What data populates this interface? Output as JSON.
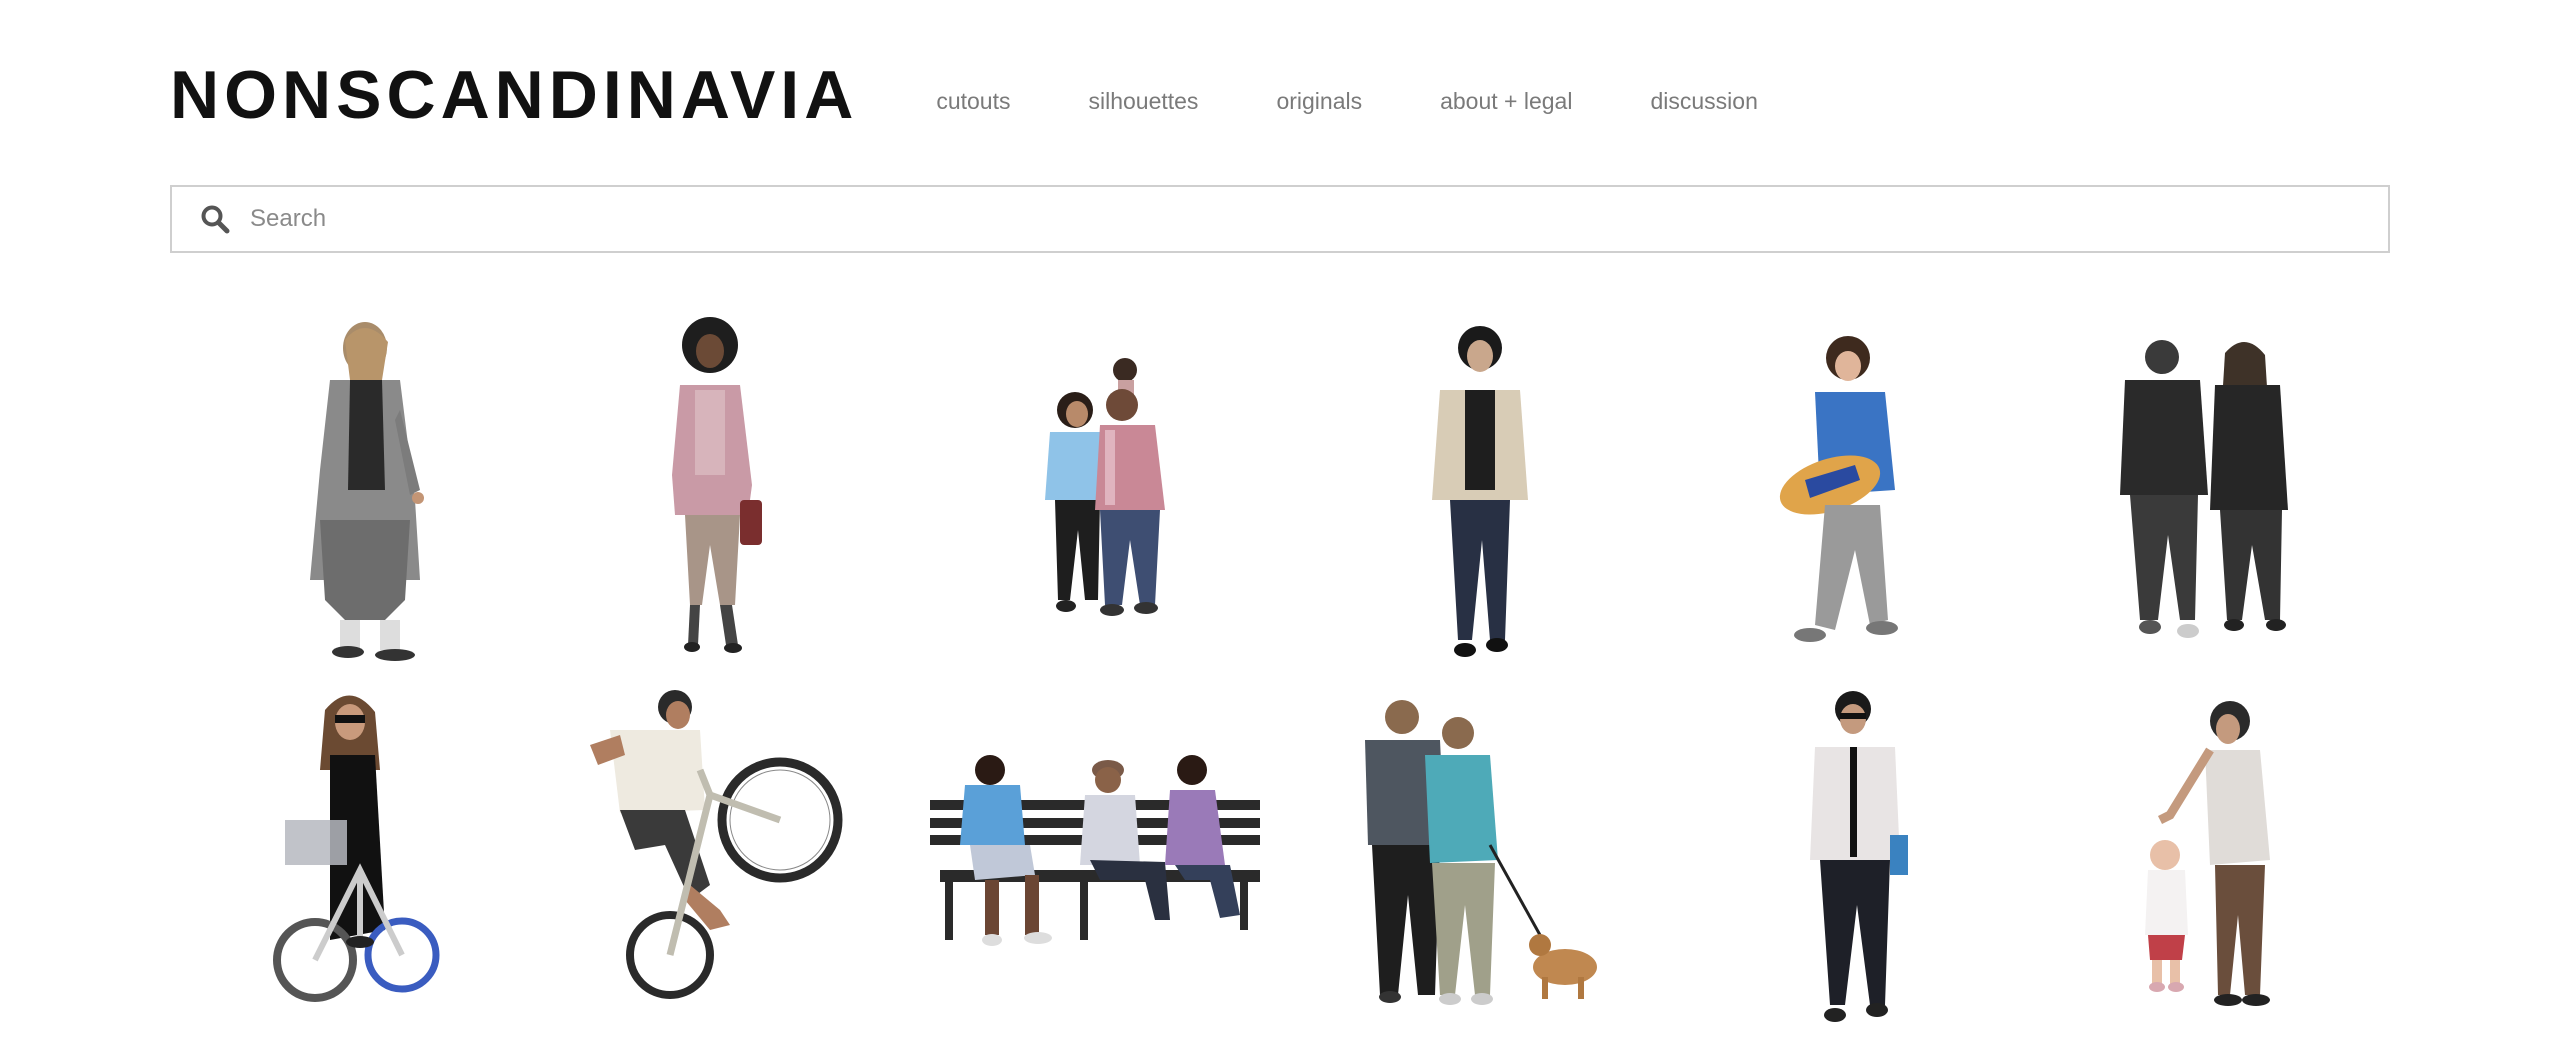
{
  "site": {
    "logo": "NONSCANDINAVIA"
  },
  "nav": {
    "items": [
      {
        "label": "cutouts"
      },
      {
        "label": "silhouettes"
      },
      {
        "label": "originals"
      },
      {
        "label": "about + legal"
      },
      {
        "label": "discussion"
      }
    ]
  },
  "search": {
    "placeholder": "Search",
    "value": ""
  },
  "colors": {
    "logo": "#111111",
    "nav_text": "#7a7a7a",
    "search_border": "#cfcfcf",
    "background": "#ffffff"
  },
  "gallery": {
    "items": [
      {
        "name": "cutout-long-coat-walker"
      },
      {
        "name": "cutout-pink-coat-woman"
      },
      {
        "name": "cutout-couple-with-child"
      },
      {
        "name": "cutout-man-beige-jacket"
      },
      {
        "name": "cutout-boy-with-skateboard"
      },
      {
        "name": "cutout-couple-from-behind"
      },
      {
        "name": "cutout-woman-on-bicycle"
      },
      {
        "name": "cutout-bmx-wheelie"
      },
      {
        "name": "cutout-people-on-bench"
      },
      {
        "name": "cutout-men-walking-dog"
      },
      {
        "name": "cutout-man-with-tie"
      },
      {
        "name": "cutout-parent-with-toddler"
      }
    ]
  }
}
